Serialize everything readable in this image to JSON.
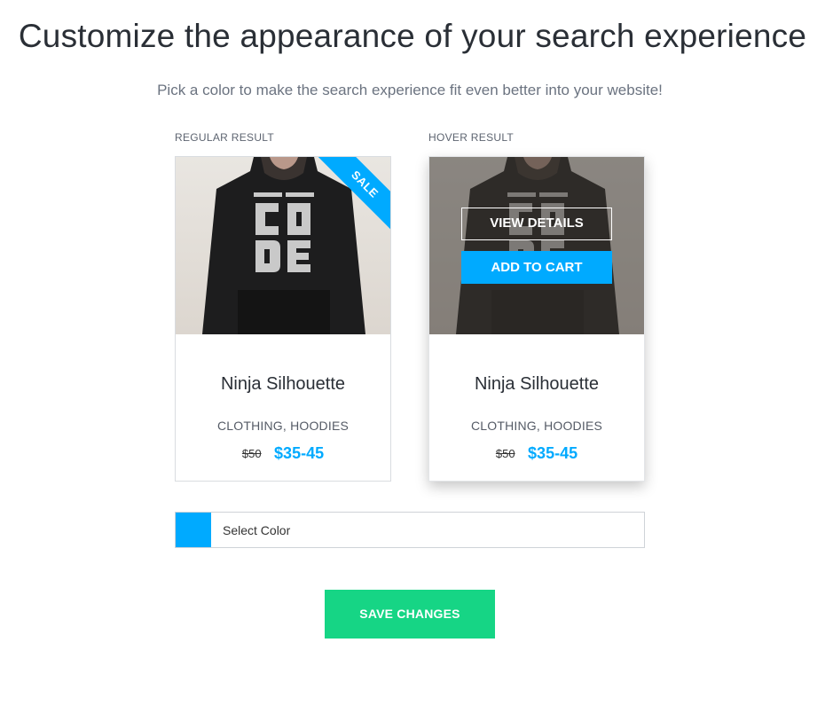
{
  "header": {
    "title": "Customize the appearance of your search experience",
    "subtitle": "Pick a color to make the search experience fit even better into your website!"
  },
  "regular_result": {
    "label": "REGULAR RESULT",
    "badge": "SALE",
    "product_name": "Ninja Silhouette",
    "categories": "CLOTHING, HOODIES",
    "old_price": "$50",
    "new_price": "$35-45",
    "image_icon": "hoodie-image"
  },
  "hover_result": {
    "label": "HOVER RESULT",
    "view_details_label": "VIEW DETAILS",
    "add_to_cart_label": "ADD TO CART",
    "product_name": "Ninja Silhouette",
    "categories": "CLOTHING, HOODIES",
    "old_price": "$50",
    "new_price": "$35-45",
    "image_icon": "hoodie-image"
  },
  "color_picker": {
    "label": "Select Color",
    "selected_color": "#00aaff"
  },
  "actions": {
    "save_label": "SAVE CHANGES"
  },
  "colors": {
    "accent": "#00aaff",
    "save_button": "#16d585"
  }
}
